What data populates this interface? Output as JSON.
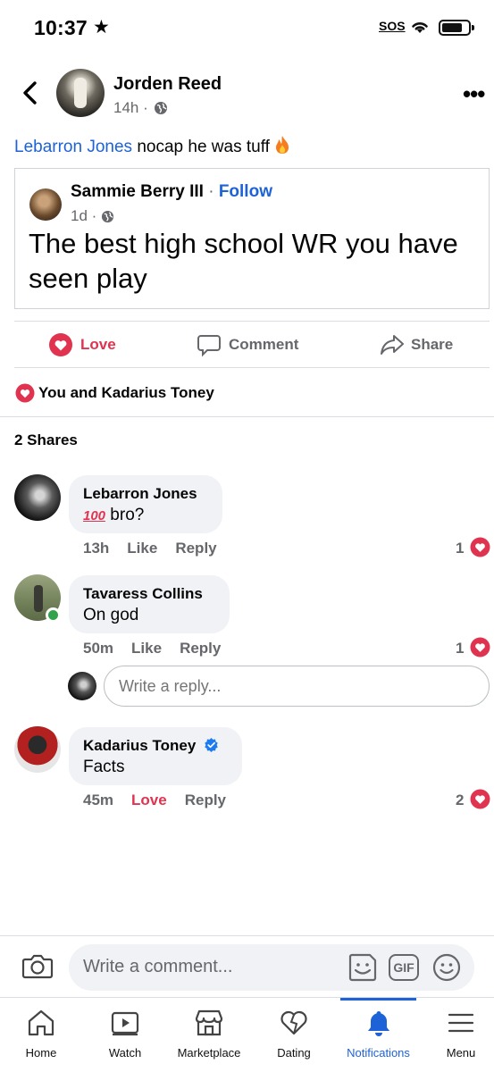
{
  "status_bar": {
    "time": "10:37",
    "star": "★",
    "sos": "SOS"
  },
  "post": {
    "author": "Jorden Reed",
    "time": "14h ·",
    "mention": "Lebarron Jones",
    "text": " nocap he was tuff",
    "shared": {
      "author": "Sammie Berry III",
      "separator": " · ",
      "follow": "Follow",
      "time": "1d ·",
      "text": "The best high school WR you have seen play"
    }
  },
  "actions": {
    "love": "Love",
    "comment": "Comment",
    "share": "Share"
  },
  "reactions": {
    "text": "You and Kadarius Toney"
  },
  "shares": "2 Shares",
  "comments": [
    {
      "name": "Lebarron Jones",
      "emoji": "100",
      "text": " bro?",
      "time": "13h",
      "like": "Like",
      "reply": "Reply",
      "reactions": "1"
    },
    {
      "name": "Tavaress Collins",
      "text": "On god",
      "time": "50m",
      "like": "Like",
      "reply": "Reply",
      "reactions": "1"
    },
    {
      "name": "Kadarius Toney",
      "text": "Facts",
      "time": "45m",
      "like": "Love",
      "reply": "Reply",
      "reactions": "2"
    }
  ],
  "reply_box": {
    "placeholder": "Write a reply..."
  },
  "comment_box": {
    "placeholder": "Write a comment...",
    "gif": "GIF"
  },
  "tabs": [
    {
      "label": "Home",
      "icon": "home-icon"
    },
    {
      "label": "Watch",
      "icon": "watch-icon"
    },
    {
      "label": "Marketplace",
      "icon": "marketplace-icon"
    },
    {
      "label": "Dating",
      "icon": "dating-icon"
    },
    {
      "label": "Notifications",
      "icon": "bell-icon",
      "active": true
    },
    {
      "label": "Menu",
      "icon": "menu-icon"
    }
  ],
  "colors": {
    "accent": "#1d62d6",
    "love": "#e0334f",
    "secondary_text": "#65676b",
    "online": "#31a24c"
  }
}
